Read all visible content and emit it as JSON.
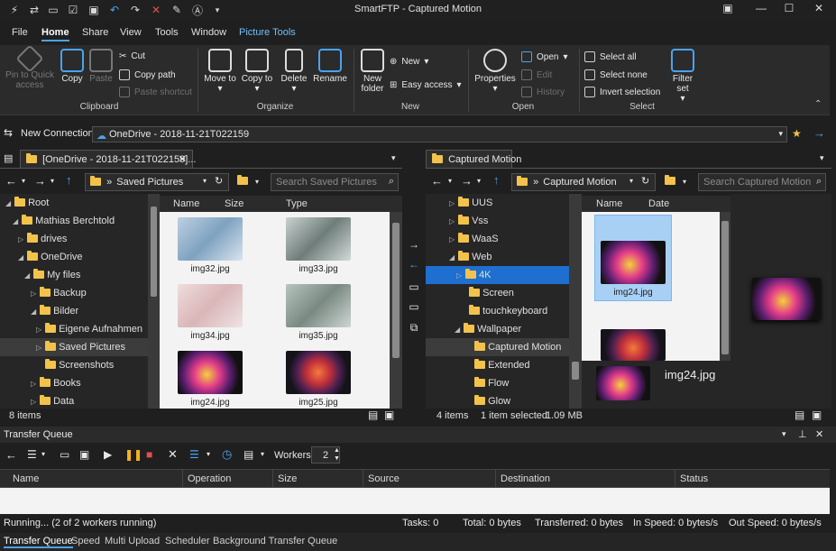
{
  "app": {
    "title": "SmartFTP - Captured Motion"
  },
  "menu": {
    "items": [
      "File",
      "Home",
      "Share",
      "View",
      "Tools",
      "Window",
      "Picture Tools"
    ]
  },
  "ribbon": {
    "clipboard": {
      "label": "Clipboard",
      "pin": "Pin to Quick access",
      "copy": "Copy",
      "paste": "Paste",
      "cut": "Cut",
      "copy_path": "Copy path",
      "paste_shortcut": "Paste shortcut"
    },
    "organize": {
      "label": "Organize",
      "move_to": "Move to",
      "copy_to": "Copy to",
      "delete": "Delete",
      "rename": "Rename"
    },
    "new": {
      "label": "New",
      "new_folder": "New folder",
      "new": "New",
      "easy_access": "Easy access"
    },
    "open": {
      "label": "Open",
      "properties": "Properties",
      "open": "Open",
      "edit": "Edit",
      "history": "History"
    },
    "select": {
      "label": "Select",
      "select_all": "Select all",
      "select_none": "Select none",
      "invert": "Invert selection",
      "filter_set": "Filter set"
    }
  },
  "connection": {
    "label": "New Connection",
    "value": "OneDrive - 2018-11-21T022159"
  },
  "left": {
    "tab": "[OneDrive - 2018-11-21T022159]...",
    "path": "Saved Pictures",
    "search_placeholder": "Search Saved Pictures",
    "tree": [
      "Root",
      "Mathias Berchtold",
      "drives",
      "OneDrive",
      "My files",
      "Backup",
      "Bilder",
      "Eigene Aufnahmen",
      "Saved Pictures",
      "Screenshots",
      "Books",
      "Data"
    ],
    "columns": [
      "Name",
      "Size",
      "Type"
    ],
    "files": [
      "img32.jpg",
      "img33.jpg",
      "img34.jpg",
      "img35.jpg",
      "img24.jpg",
      "img25.jpg"
    ],
    "status": "8 items"
  },
  "right": {
    "tab": "Captured Motion",
    "path": "Captured Motion",
    "search_placeholder": "Search Captured Motion",
    "tree": [
      "UUS",
      "Vss",
      "WaaS",
      "Web",
      "4K",
      "Screen",
      "touchkeyboard",
      "Wallpaper",
      "Captured Motion",
      "Extended",
      "Flow",
      "Glow"
    ],
    "columns": [
      "Name",
      "Date"
    ],
    "files": [
      "img24.jpg"
    ],
    "preview_name": "img24.jpg",
    "status_items": "4 items",
    "status_sel": "1 item selected",
    "status_size": "1.09 MB"
  },
  "queue": {
    "title": "Transfer Queue",
    "workers_label": "Workers",
    "workers": "2",
    "columns": [
      "Name",
      "Operation",
      "Size",
      "Source",
      "Destination",
      "Status"
    ],
    "status": "Running... (2 of 2 workers running)",
    "tasks": "Tasks: 0",
    "total": "Total: 0 bytes",
    "transferred": "Transferred: 0 bytes",
    "in_speed": "In Speed: 0 bytes/s",
    "out_speed": "Out Speed: 0 bytes/s",
    "tabs": [
      "Transfer Queue",
      "Speed",
      "Multi Upload",
      "Scheduler",
      "Background Transfer Queue"
    ]
  }
}
